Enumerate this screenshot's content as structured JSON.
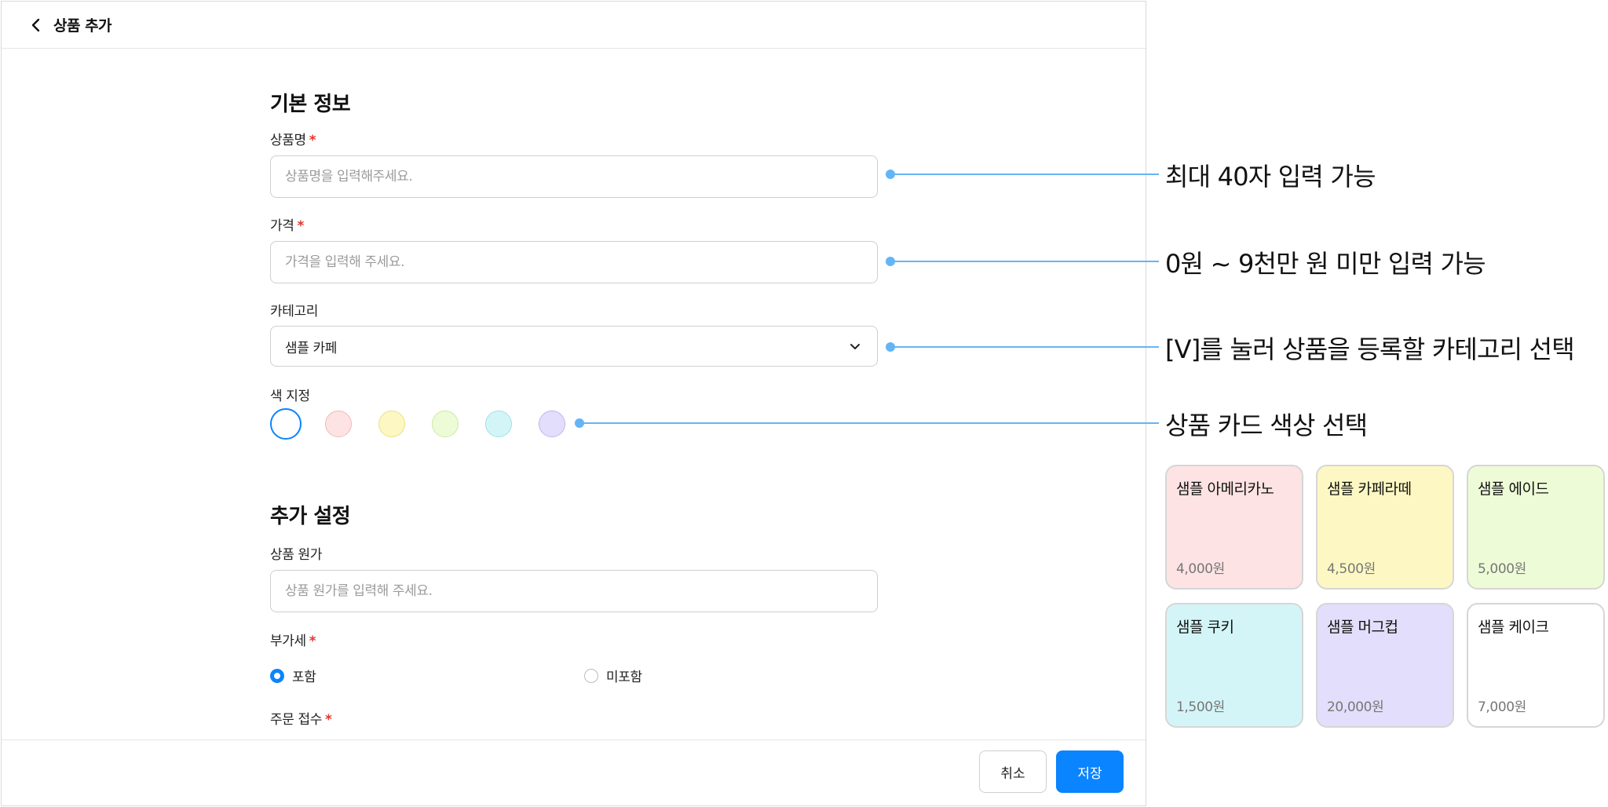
{
  "header": {
    "title": "상품 추가"
  },
  "basic_info": {
    "title": "기본 정보",
    "name_field": {
      "label": "상품명",
      "required_mark": "*",
      "placeholder": "상품명을 입력해주세요.",
      "value": ""
    },
    "price_field": {
      "label": "가격",
      "required_mark": "*",
      "placeholder": "가격을 입력해 주세요.",
      "value": ""
    },
    "category_field": {
      "label": "카테고리",
      "selected": "샘플 카페"
    },
    "color_field": {
      "label": "색 지정",
      "swatches": [
        {
          "color": "#ffffff",
          "border": "#0a84ff",
          "selected": true
        },
        {
          "color": "#fde3e3",
          "border": "#f3b8b8",
          "selected": false
        },
        {
          "color": "#fdf8c3",
          "border": "#ecdf8a",
          "selected": false
        },
        {
          "color": "#eefbd7",
          "border": "#cde9a4",
          "selected": false
        },
        {
          "color": "#d4f5f7",
          "border": "#9fe0e6",
          "selected": false
        },
        {
          "color": "#e3defb",
          "border": "#bfb4f0",
          "selected": false
        }
      ]
    }
  },
  "extra_settings": {
    "title": "추가 설정",
    "cost_field": {
      "label": "상품 원가",
      "placeholder": "상품 원가를 입력해 주세요.",
      "value": ""
    },
    "vat_field": {
      "label": "부가세",
      "required_mark": "*",
      "options": [
        {
          "label": "포함",
          "selected": true
        },
        {
          "label": "미포함",
          "selected": false
        }
      ]
    },
    "order_field": {
      "label": "주문 접수",
      "required_mark": "*"
    }
  },
  "footer": {
    "cancel_label": "취소",
    "save_label": "저장"
  },
  "annotations": [
    "최대 40자 입력 가능",
    "0원 ~ 9천만 원 미만 입력 가능",
    "[V]를 눌러 상품을 등록할 카테고리 선택",
    "상품 카드 색상 선택"
  ],
  "sample_cards": [
    {
      "name": "샘플 아메리카노",
      "price": "4,000원",
      "color": "#fde3e3"
    },
    {
      "name": "샘플 카페라떼",
      "price": "4,500원",
      "color": "#fdf8c3"
    },
    {
      "name": "샘플 에이드",
      "price": "5,000원",
      "color": "#eefbd7"
    },
    {
      "name": "샘플 쿠키",
      "price": "1,500원",
      "color": "#d4f5f7"
    },
    {
      "name": "샘플 머그컵",
      "price": "20,000원",
      "color": "#e3defb"
    },
    {
      "name": "샘플 케이크",
      "price": "7,000원",
      "color": "#ffffff"
    }
  ],
  "colors": {
    "accent": "#0a84ff",
    "required": "#e5342f",
    "leader": "#64b5f6"
  }
}
